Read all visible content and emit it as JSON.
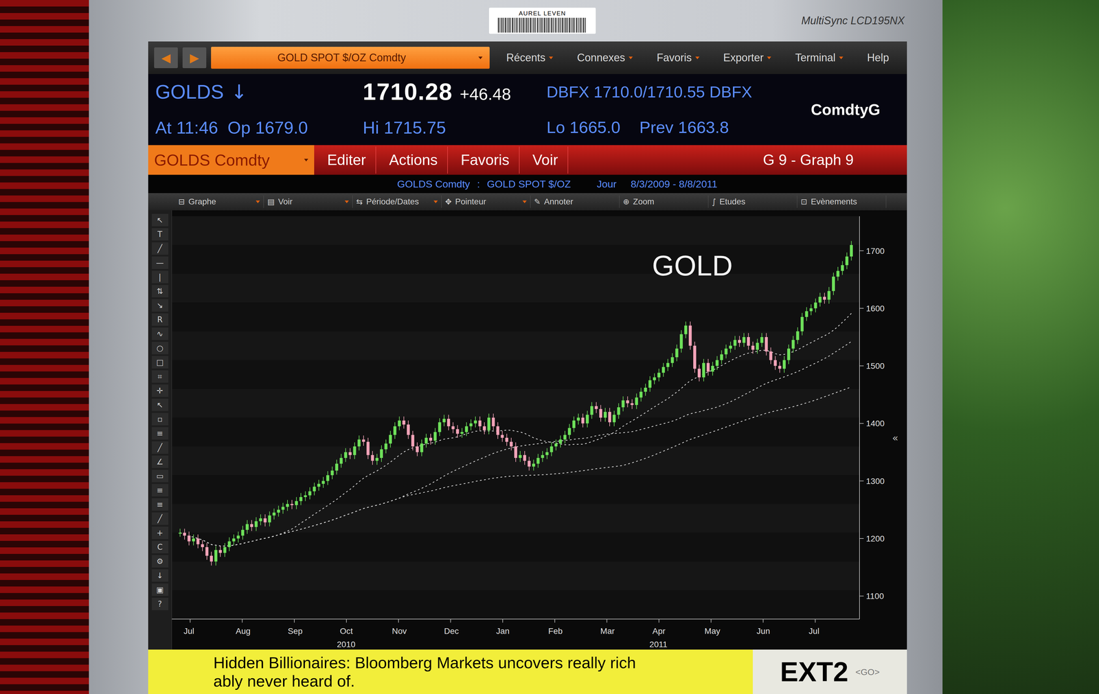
{
  "monitor": {
    "brand": "MultiSync LCD195NX",
    "sticker": "AUREL LEVEN"
  },
  "nav": {
    "back": "◀",
    "forward": "▶",
    "security": "GOLD SPOT $/OZ Comdty",
    "menus": [
      "Récents",
      "Connexes",
      "Favoris",
      "Exporter",
      "Terminal",
      "Help"
    ]
  },
  "quote": {
    "ticker": "GOLDS",
    "arrow": "↓",
    "price": "1710.28",
    "change": "+46.48",
    "time": "At 11:46",
    "open": "Op 1679.0",
    "high": "Hi 1715.75",
    "low": "Lo 1665.0",
    "prev": "Prev 1663.8",
    "bidask": "DBFX 1710.0/1710.55 DBFX",
    "market": "ComdtyG"
  },
  "menubar": {
    "field": "GOLDS Comdty",
    "items": [
      "Editer",
      "Actions",
      "Favoris",
      "Voir"
    ],
    "page": "G 9 - Graph 9"
  },
  "subheader": {
    "security": "GOLDS Comdty",
    "separator": ":",
    "description": "GOLD SPOT $/OZ",
    "period": "Jour",
    "range": "8/3/2009 - 8/8/2011"
  },
  "chart_toolbar": [
    {
      "icon": "⊟",
      "label": "Graphe"
    },
    {
      "icon": "▤",
      "label": "Voir"
    },
    {
      "icon": "⇆",
      "label": "Période/Dates"
    },
    {
      "icon": "✥",
      "label": "Pointeur"
    },
    {
      "icon": "✎",
      "label": "Annoter"
    },
    {
      "icon": "⊕",
      "label": "Zoom"
    },
    {
      "icon": "∫",
      "label": "Etudes"
    },
    {
      "icon": "⊡",
      "label": "Evènements"
    }
  ],
  "side_tools": [
    "↖",
    "T",
    "╱",
    "—",
    "|",
    "⇅",
    "↘",
    "R",
    "∿",
    "○",
    "□",
    "⌗",
    "✛",
    "↖",
    "▫",
    "≡",
    "╱",
    "∠",
    "▭",
    "≡",
    "≡",
    "╱",
    "+",
    "C",
    "⚙",
    "↓",
    "▣",
    "?"
  ],
  "chart": {
    "title": "GOLD",
    "collapse": "«",
    "y_ticks": [
      "1100",
      "1200",
      "1300",
      "1400",
      "1500",
      "1600",
      "1700"
    ],
    "months": [
      {
        "label": "Jul"
      },
      {
        "label": "Aug"
      },
      {
        "label": "Sep"
      },
      {
        "label": "Oct",
        "year": "2010"
      },
      {
        "label": "Nov"
      },
      {
        "label": "Dec"
      },
      {
        "label": "Jan"
      },
      {
        "label": "Feb"
      },
      {
        "label": "Mar"
      },
      {
        "label": "Apr",
        "year": "2011"
      },
      {
        "label": "May"
      },
      {
        "label": "Jun"
      },
      {
        "label": "Jul"
      }
    ],
    "close": [
      1210,
      1205,
      1195,
      1200,
      1190,
      1185,
      1170,
      1160,
      1180,
      1175,
      1185,
      1195,
      1200,
      1205,
      1215,
      1225,
      1220,
      1230,
      1235,
      1228,
      1240,
      1245,
      1250,
      1255,
      1260,
      1258,
      1265,
      1272,
      1275,
      1282,
      1290,
      1295,
      1300,
      1310,
      1318,
      1330,
      1340,
      1350,
      1345,
      1360,
      1372,
      1368,
      1345,
      1335,
      1340,
      1355,
      1365,
      1380,
      1395,
      1405,
      1398,
      1380,
      1360,
      1350,
      1365,
      1375,
      1370,
      1385,
      1402,
      1408,
      1395,
      1390,
      1382,
      1385,
      1395,
      1400,
      1405,
      1395,
      1388,
      1410,
      1395,
      1380,
      1375,
      1368,
      1360,
      1340,
      1345,
      1335,
      1325,
      1330,
      1340,
      1345,
      1350,
      1360,
      1365,
      1372,
      1380,
      1392,
      1405,
      1410,
      1400,
      1415,
      1430,
      1425,
      1410,
      1420,
      1402,
      1415,
      1428,
      1440,
      1435,
      1432,
      1445,
      1455,
      1462,
      1475,
      1480,
      1488,
      1498,
      1505,
      1515,
      1530,
      1555,
      1570,
      1535,
      1495,
      1480,
      1505,
      1490,
      1500,
      1510,
      1520,
      1530,
      1535,
      1545,
      1540,
      1550,
      1535,
      1528,
      1540,
      1550,
      1525,
      1510,
      1500,
      1495,
      1510,
      1530,
      1545,
      1560,
      1585,
      1595,
      1600,
      1610,
      1620,
      1615,
      1630,
      1655,
      1665,
      1675,
      1690,
      1710
    ]
  },
  "ticker": {
    "lines": [
      "Hidden Billionaires: Bloomberg Markets uncovers really rich",
      "ably never heard of."
    ],
    "exchange": "EXT2",
    "go": "<GO>"
  }
}
